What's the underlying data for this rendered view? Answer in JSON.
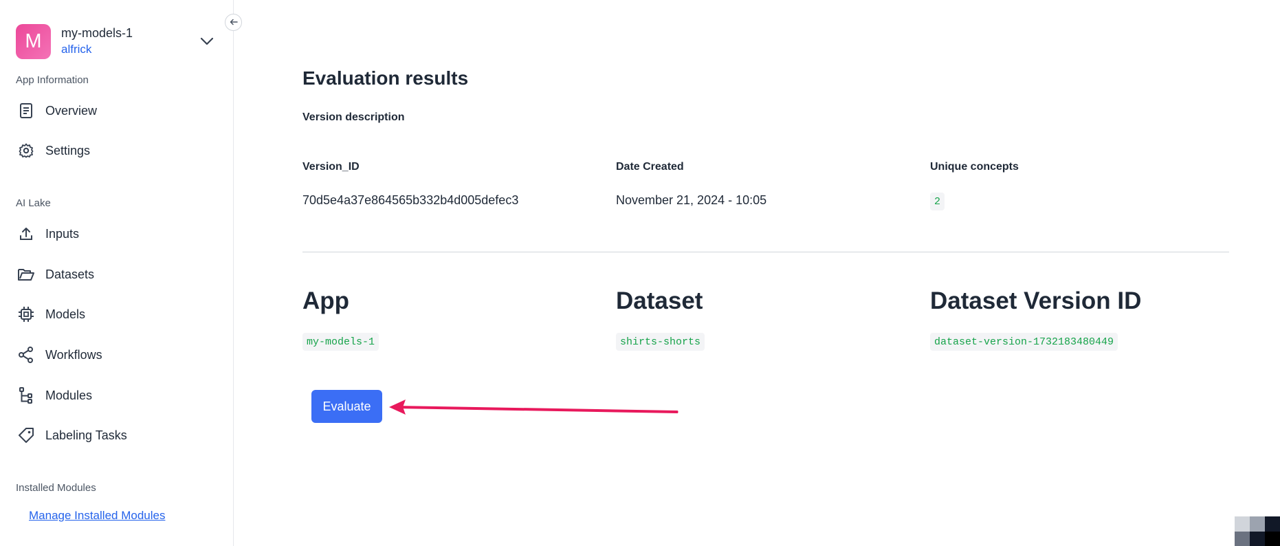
{
  "sidebar": {
    "app": {
      "avatar_letter": "M",
      "name": "my-models-1",
      "user": "alfrick"
    },
    "sections": {
      "app_information": "App Information",
      "ai_lake": "AI Lake",
      "installed_modules": "Installed Modules"
    },
    "items": [
      {
        "label": "Overview",
        "icon": "document-icon"
      },
      {
        "label": "Settings",
        "icon": "gear-icon"
      },
      {
        "label": "Inputs",
        "icon": "upload-icon"
      },
      {
        "label": "Datasets",
        "icon": "folder-icon"
      },
      {
        "label": "Models",
        "icon": "chip-icon"
      },
      {
        "label": "Workflows",
        "icon": "share-icon"
      },
      {
        "label": "Modules",
        "icon": "branch-icon"
      },
      {
        "label": "Labeling Tasks",
        "icon": "tag-icon"
      }
    ],
    "manage_link": "Manage Installed Modules"
  },
  "main": {
    "title": "Evaluation results",
    "version_description_label": "Version description",
    "info": {
      "version_id_label": "Version_ID",
      "version_id_value": "70d5e4a37e864565b332b4d005defec3",
      "date_label": "Date Created",
      "date_value": "November 21, 2024 - 10:05",
      "concepts_label": "Unique concepts",
      "concepts_value": "2"
    },
    "details": {
      "app_label": "App",
      "app_value": "my-models-1",
      "dataset_label": "Dataset",
      "dataset_value": "shirts-shorts",
      "dataset_version_label": "Dataset Version ID",
      "dataset_version_value": "dataset-version-1732183480449"
    },
    "evaluate_button": "Evaluate"
  },
  "colors": {
    "accent": "#3b6ef5",
    "link": "#2563eb",
    "code_green": "#16a34a",
    "annotation_arrow": "#e8195c",
    "avatar": "#ec4899"
  }
}
